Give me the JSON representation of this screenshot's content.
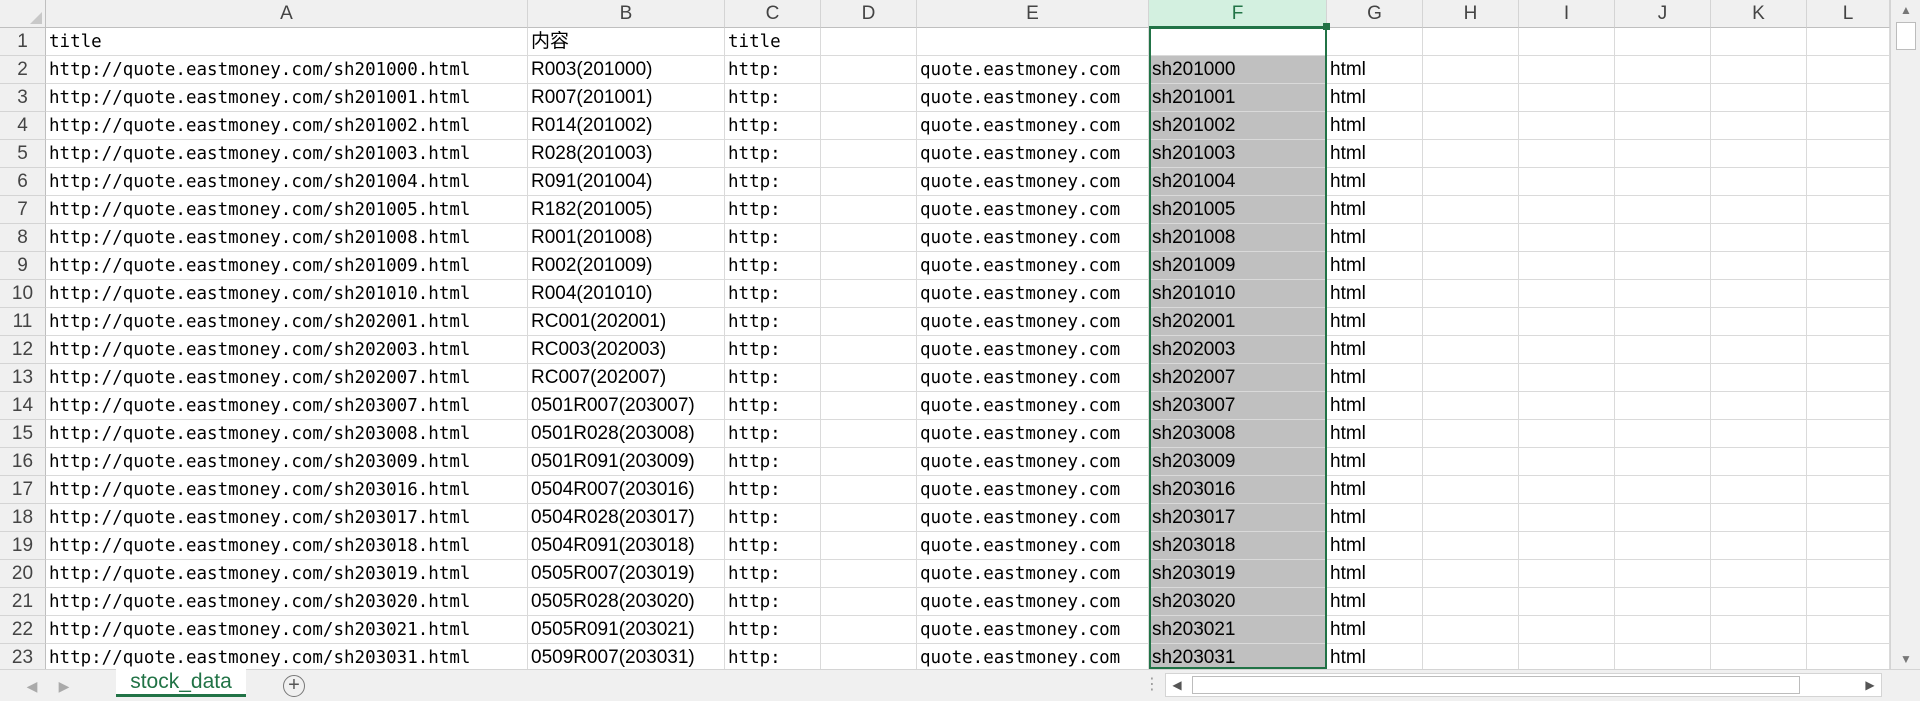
{
  "columns": [
    "A",
    "B",
    "C",
    "D",
    "E",
    "F",
    "G",
    "H",
    "I",
    "J",
    "K",
    "L"
  ],
  "selected_column": "F",
  "rows": [
    {
      "n": "1",
      "A": "title",
      "B": "内容",
      "C": "title",
      "E": "",
      "F": "",
      "G": ""
    },
    {
      "n": "2",
      "A": "http://quote.eastmoney.com/sh201000.html",
      "B": "R003(201000)",
      "C": "http:",
      "E": "quote.eastmoney.com",
      "F": "sh201000",
      "G": "html"
    },
    {
      "n": "3",
      "A": "http://quote.eastmoney.com/sh201001.html",
      "B": "R007(201001)",
      "C": "http:",
      "E": "quote.eastmoney.com",
      "F": "sh201001",
      "G": "html"
    },
    {
      "n": "4",
      "A": "http://quote.eastmoney.com/sh201002.html",
      "B": "R014(201002)",
      "C": "http:",
      "E": "quote.eastmoney.com",
      "F": "sh201002",
      "G": "html"
    },
    {
      "n": "5",
      "A": "http://quote.eastmoney.com/sh201003.html",
      "B": "R028(201003)",
      "C": "http:",
      "E": "quote.eastmoney.com",
      "F": "sh201003",
      "G": "html"
    },
    {
      "n": "6",
      "A": "http://quote.eastmoney.com/sh201004.html",
      "B": "R091(201004)",
      "C": "http:",
      "E": "quote.eastmoney.com",
      "F": "sh201004",
      "G": "html"
    },
    {
      "n": "7",
      "A": "http://quote.eastmoney.com/sh201005.html",
      "B": "R182(201005)",
      "C": "http:",
      "E": "quote.eastmoney.com",
      "F": "sh201005",
      "G": "html"
    },
    {
      "n": "8",
      "A": "http://quote.eastmoney.com/sh201008.html",
      "B": "R001(201008)",
      "C": "http:",
      "E": "quote.eastmoney.com",
      "F": "sh201008",
      "G": "html"
    },
    {
      "n": "9",
      "A": "http://quote.eastmoney.com/sh201009.html",
      "B": "R002(201009)",
      "C": "http:",
      "E": "quote.eastmoney.com",
      "F": "sh201009",
      "G": "html"
    },
    {
      "n": "10",
      "A": "http://quote.eastmoney.com/sh201010.html",
      "B": "R004(201010)",
      "C": "http:",
      "E": "quote.eastmoney.com",
      "F": "sh201010",
      "G": "html"
    },
    {
      "n": "11",
      "A": "http://quote.eastmoney.com/sh202001.html",
      "B": "RC001(202001)",
      "C": "http:",
      "E": "quote.eastmoney.com",
      "F": "sh202001",
      "G": "html"
    },
    {
      "n": "12",
      "A": "http://quote.eastmoney.com/sh202003.html",
      "B": "RC003(202003)",
      "C": "http:",
      "E": "quote.eastmoney.com",
      "F": "sh202003",
      "G": "html"
    },
    {
      "n": "13",
      "A": "http://quote.eastmoney.com/sh202007.html",
      "B": "RC007(202007)",
      "C": "http:",
      "E": "quote.eastmoney.com",
      "F": "sh202007",
      "G": "html"
    },
    {
      "n": "14",
      "A": "http://quote.eastmoney.com/sh203007.html",
      "B": "0501R007(203007)",
      "C": "http:",
      "E": "quote.eastmoney.com",
      "F": "sh203007",
      "G": "html"
    },
    {
      "n": "15",
      "A": "http://quote.eastmoney.com/sh203008.html",
      "B": "0501R028(203008)",
      "C": "http:",
      "E": "quote.eastmoney.com",
      "F": "sh203008",
      "G": "html"
    },
    {
      "n": "16",
      "A": "http://quote.eastmoney.com/sh203009.html",
      "B": "0501R091(203009)",
      "C": "http:",
      "E": "quote.eastmoney.com",
      "F": "sh203009",
      "G": "html"
    },
    {
      "n": "17",
      "A": "http://quote.eastmoney.com/sh203016.html",
      "B": "0504R007(203016)",
      "C": "http:",
      "E": "quote.eastmoney.com",
      "F": "sh203016",
      "G": "html"
    },
    {
      "n": "18",
      "A": "http://quote.eastmoney.com/sh203017.html",
      "B": "0504R028(203017)",
      "C": "http:",
      "E": "quote.eastmoney.com",
      "F": "sh203017",
      "G": "html"
    },
    {
      "n": "19",
      "A": "http://quote.eastmoney.com/sh203018.html",
      "B": "0504R091(203018)",
      "C": "http:",
      "E": "quote.eastmoney.com",
      "F": "sh203018",
      "G": "html"
    },
    {
      "n": "20",
      "A": "http://quote.eastmoney.com/sh203019.html",
      "B": "0505R007(203019)",
      "C": "http:",
      "E": "quote.eastmoney.com",
      "F": "sh203019",
      "G": "html"
    },
    {
      "n": "21",
      "A": "http://quote.eastmoney.com/sh203020.html",
      "B": "0505R028(203020)",
      "C": "http:",
      "E": "quote.eastmoney.com",
      "F": "sh203020",
      "G": "html"
    },
    {
      "n": "22",
      "A": "http://quote.eastmoney.com/sh203021.html",
      "B": "0505R091(203021)",
      "C": "http:",
      "E": "quote.eastmoney.com",
      "F": "sh203021",
      "G": "html"
    },
    {
      "n": "23",
      "A": "http://quote.eastmoney.com/sh203031.html",
      "B": "0509R007(203031)",
      "C": "http:",
      "E": "quote.eastmoney.com",
      "F": "sh203031",
      "G": "html"
    }
  ],
  "sheet_tabs": [
    {
      "label": "stock_data",
      "active": true
    }
  ],
  "icons": {
    "add_sheet": "plus-circle-icon",
    "tab_prev": "triangle-left-icon",
    "tab_next": "triangle-right-icon"
  },
  "colors": {
    "accent": "#217346",
    "selected_fill": "#c0c0c0",
    "header_selected": "#d3f0e0"
  }
}
